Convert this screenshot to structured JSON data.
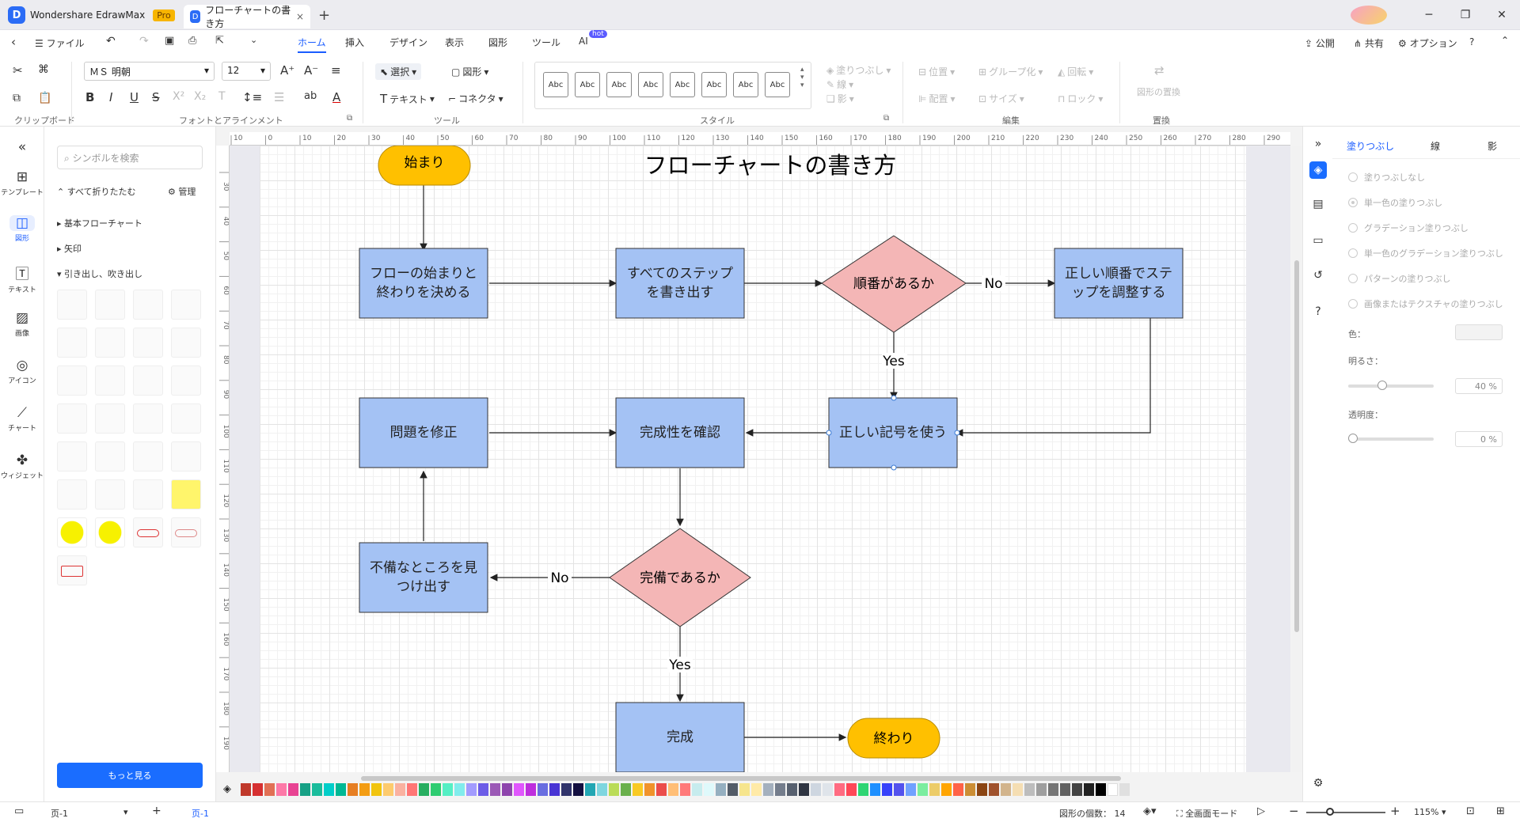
{
  "titlebar": {
    "app_name": "Wondershare EdrawMax",
    "app_badge": "Pro",
    "doc_tab": "フローチャートの書き方",
    "doc_tab_close": "×",
    "new_tab": "+"
  },
  "menubar": {
    "file": "ファイル",
    "tabs": [
      "ホーム",
      "挿入",
      "デザイン",
      "表示",
      "図形",
      "ツール",
      "AI"
    ],
    "active_tab": "ホーム",
    "ai_badge": "hot",
    "publish": "公開",
    "share": "共有",
    "options": "オプション"
  },
  "ribbon": {
    "font_name": "ＭＳ 明朝",
    "font_size": "12",
    "select": "選択",
    "shape": "図形",
    "text": "テキスト",
    "connector": "コネクタ",
    "style_samples": [
      "Abc",
      "Abc",
      "Abc",
      "Abc",
      "Abc",
      "Abc",
      "Abc",
      "Abc"
    ],
    "fill": "塗りつぶし",
    "line": "線",
    "shadow": "影",
    "position": "位置",
    "group": "グループ化",
    "rotate": "回転",
    "align": "配置",
    "size": "サイズ",
    "lock": "ロック",
    "replace_shape": "図形の置換",
    "groups": {
      "clipboard": "クリップボード",
      "font_align": "フォントとアラインメント",
      "tools": "ツール",
      "style": "スタイル",
      "edit": "編集",
      "replace": "置換"
    }
  },
  "leftnav": {
    "items": [
      "テンプレート",
      "図形",
      "テキスト",
      "画像",
      "アイコン",
      "チャート",
      "ウィジェット"
    ],
    "active": "図形"
  },
  "library": {
    "search_placeholder": "シンボルを検索",
    "collapse_all": "すべて折りたたむ",
    "manage": "管理",
    "categories": [
      "基本フローチャート",
      "矢印",
      "引き出し、吹き出し"
    ],
    "more": "もっと見る"
  },
  "rulers": {
    "top": [
      "10",
      "0",
      "10",
      "20",
      "30",
      "40",
      "50",
      "60",
      "70",
      "80",
      "90",
      "100",
      "110",
      "120",
      "130",
      "140",
      "150",
      "160",
      "170",
      "180",
      "190",
      "200",
      "210",
      "220",
      "230",
      "240",
      "250",
      "260",
      "270",
      "280",
      "290"
    ],
    "left": [
      "30",
      "40",
      "50",
      "60",
      "70",
      "80",
      "90",
      "100",
      "110",
      "120",
      "130",
      "140",
      "150",
      "160",
      "170",
      "180",
      "190"
    ]
  },
  "diagram": {
    "title": "フローチャートの書き方",
    "nodes": {
      "start": "始まり",
      "decide_start_end": "フローの始まりと終わりを決める",
      "write_steps": "すべてのステップを書き出す",
      "is_ordered": "順番があるか",
      "adjust_order": "正しい順番でステップを調整する",
      "use_symbols": "正しい記号を使う",
      "check_complete": "完成性を確認",
      "fix_problem": "問題を修正",
      "is_complete": "完備であるか",
      "find_flaws": "不備なところを見つけ出す",
      "done": "完成",
      "end": "終わり"
    },
    "labels": {
      "no1": "No",
      "yes1": "Yes",
      "no2": "No",
      "yes2": "Yes"
    },
    "colors": {
      "terminal": "#ffc000",
      "process": "#a4c2f4",
      "decision": "#f4b6b6"
    }
  },
  "palette": [
    "#c0392b",
    "#d63031",
    "#e17055",
    "#fd79a8",
    "#e84393",
    "#16a085",
    "#1abc9c",
    "#00cec9",
    "#00b894",
    "#e67e22",
    "#f39c12",
    "#f1c40f",
    "#fdcb6e",
    "#fab1a0",
    "#ff7675",
    "#27ae60",
    "#2ecc71",
    "#55efc4",
    "#81ecec",
    "#a29bfe",
    "#6c5ce7",
    "#9b59b6",
    "#8e44ad",
    "#e056fd",
    "#be2edd",
    "#686de0",
    "#4834d4",
    "#30336b",
    "#130f40",
    "#22a6b3",
    "#7ed6df",
    "#badc58",
    "#6ab04c",
    "#f9ca24",
    "#f0932b",
    "#eb4d4b",
    "#ffbe76",
    "#ff7979",
    "#c7ecee",
    "#dff9fb",
    "#95afc0",
    "#535c68",
    "#f6e58d",
    "#ffeaa7",
    "#a4b0be",
    "#747d8c",
    "#57606f",
    "#2f3542",
    "#ced6e0",
    "#dfe4ea",
    "#ff6b81",
    "#ff4757",
    "#2ed573",
    "#1e90ff",
    "#3742fa",
    "#5352ed",
    "#70a1ff",
    "#7bed9f",
    "#eccc68",
    "#ffa502",
    "#ff6348",
    "#cc8e35",
    "#8b4513",
    "#a0522d",
    "#d2b48c",
    "#f5deb3",
    "#bdbdbd",
    "#9e9e9e",
    "#757575",
    "#616161",
    "#424242",
    "#212121",
    "#000000",
    "#ffffff",
    "#e0e0e0"
  ],
  "rightpanel": {
    "tabs": [
      "塗りつぶし",
      "線",
      "影"
    ],
    "active_tab": "塗りつぶし",
    "options": [
      "塗りつぶしなし",
      "単一色の塗りつぶし",
      "グラデーション塗りつぶし",
      "単一色のグラデーション塗りつぶし",
      "パターンの塗りつぶし",
      "画像またはテクスチャの塗りつぶし"
    ],
    "color_label": "色：",
    "brightness_label": "明るさ：",
    "brightness_value": "40 %",
    "brightness_level": 0.4,
    "transparency_label": "透明度：",
    "transparency_value": "0 %",
    "transparency_level": 0
  },
  "statusbar": {
    "page_select": "页-1",
    "add_page": "+",
    "page_tab": "页-1",
    "shape_count": "図形の個数： 14",
    "fullscreen": "全画面モード",
    "zoom": "115%",
    "zoom_out": "−",
    "zoom_in": "+"
  }
}
